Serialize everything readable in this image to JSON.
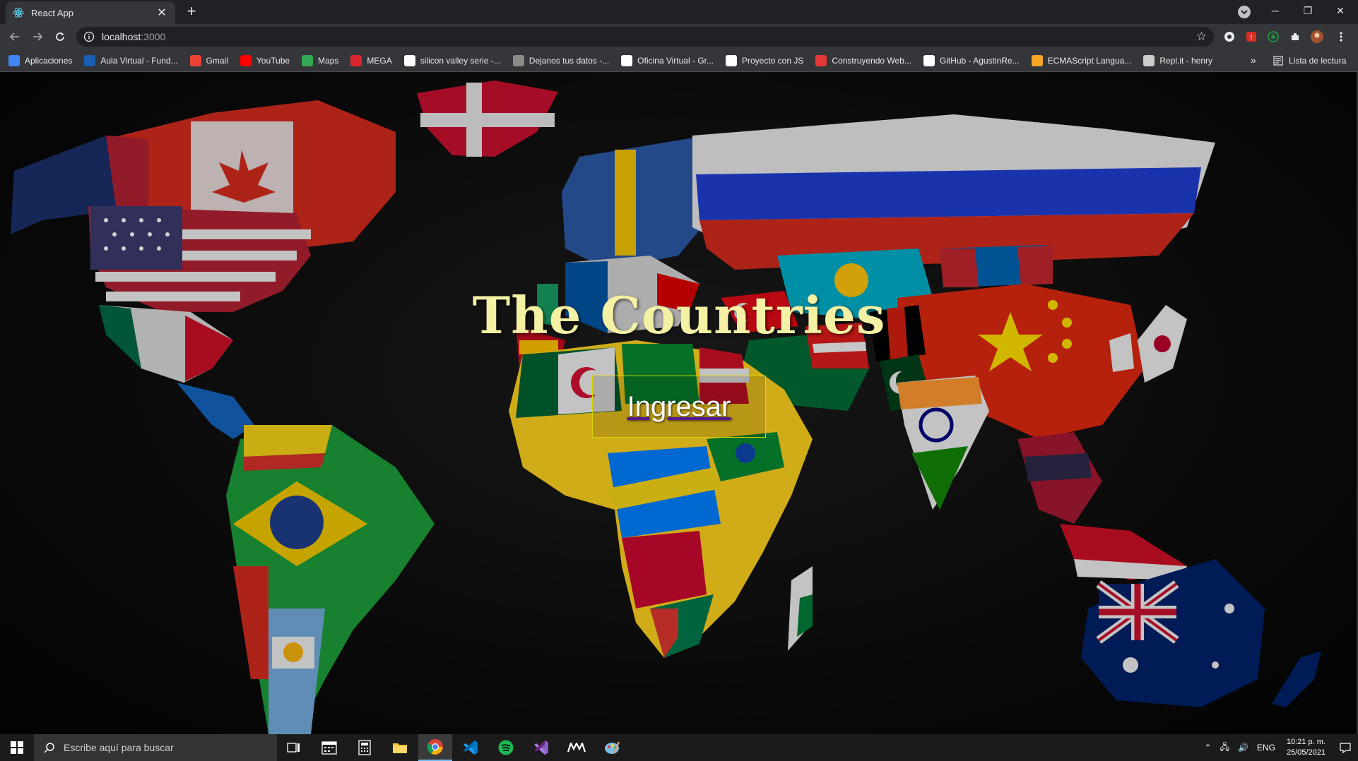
{
  "browser": {
    "tab_title": "React App",
    "tab_close": "✕",
    "new_tab": "+",
    "url_host": "localhost",
    "url_port": ":3000",
    "window_buttons": {
      "minimize": "─",
      "restore": "❐",
      "close": "✕"
    },
    "bookmarks": [
      {
        "label": "Aplicaciones",
        "icon": "apps-grid-icon",
        "color": "#4285f4"
      },
      {
        "label": "Aula Virtual - Fund...",
        "icon": "fu-icon",
        "color": "#1a5fb4"
      },
      {
        "label": "Gmail",
        "icon": "gmail-icon",
        "color": "#ea4335"
      },
      {
        "label": "YouTube",
        "icon": "youtube-icon",
        "color": "#ff0000"
      },
      {
        "label": "Maps",
        "icon": "maps-icon",
        "color": "#34a853"
      },
      {
        "label": "MEGA",
        "icon": "mega-icon",
        "color": "#d9272e"
      },
      {
        "label": "silicon valley serie -...",
        "icon": "google-icon",
        "color": "#ffffff"
      },
      {
        "label": "Dejanos tus datos -...",
        "icon": "forms-icon",
        "color": "#8a8a8a"
      },
      {
        "label": "Oficina Virtual - Gr...",
        "icon": "office-icon",
        "color": "#ffffff"
      },
      {
        "label": "Proyecto con JS",
        "icon": "globe-icon",
        "color": "#ffffff"
      },
      {
        "label": "Construyendo Web...",
        "icon": "yt-studio-icon",
        "color": "#e53935"
      },
      {
        "label": "GitHub - AgustinRe...",
        "icon": "github-icon",
        "color": "#ffffff"
      },
      {
        "label": "ECMAScript Langua...",
        "icon": "ecma-icon",
        "color": "#f5a623"
      },
      {
        "label": "Repl.it - henry",
        "icon": "replit-icon",
        "color": "#cccccc"
      }
    ],
    "bookmarks_more": "»",
    "reading_list": "Lista de lectura"
  },
  "page": {
    "title": "The Countries",
    "enter_button": "Ingresar",
    "colors": {
      "title": "#f4f0a4",
      "button_border": "#d7d300",
      "button_text": "#ffffff"
    }
  },
  "taskbar": {
    "search_placeholder": "Escribe aquí para buscar",
    "apps": [
      "task-view-icon",
      "calendar-icon",
      "calculator-icon",
      "file-explorer-icon",
      "chrome-icon",
      "vscode-icon",
      "spotify-icon",
      "visual-studio-icon",
      "mw-icon",
      "paint-icon"
    ],
    "tray_lang": "ENG",
    "clock_time": "10:21 p. m.",
    "clock_date": "25/05/2021"
  }
}
